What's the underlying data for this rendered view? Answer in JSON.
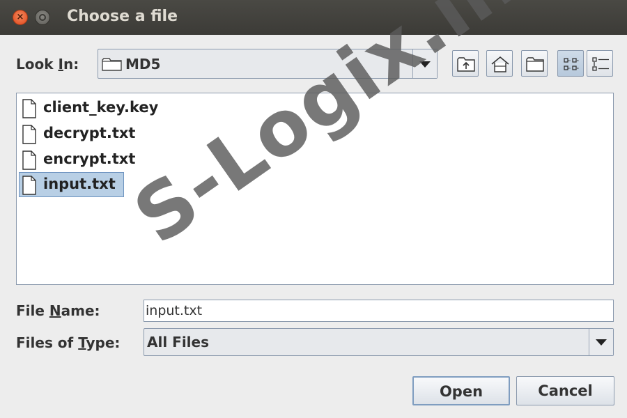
{
  "window": {
    "title": "Choose a file",
    "close_glyph": "×"
  },
  "look_in": {
    "label_pre": "Look ",
    "label_mnemonic": "I",
    "label_post": "n:",
    "value": "MD5",
    "icon": "folder-icon"
  },
  "toolbar": {
    "buttons": [
      {
        "name": "up-one-level-button",
        "icon": "folder-up-icon"
      },
      {
        "name": "home-button",
        "icon": "home-icon"
      },
      {
        "name": "new-folder-button",
        "icon": "new-folder-icon"
      },
      {
        "name": "list-view-button",
        "icon": "list-view-icon",
        "selected": true
      },
      {
        "name": "details-view-button",
        "icon": "details-view-icon"
      }
    ]
  },
  "files": [
    {
      "name": "client_key.key"
    },
    {
      "name": "decrypt.txt"
    },
    {
      "name": "encrypt.txt"
    },
    {
      "name": "input.txt",
      "selected": true
    }
  ],
  "file_name": {
    "label_pre": "File ",
    "label_mnemonic": "N",
    "label_post": "ame:",
    "value": "input.txt"
  },
  "files_of_type": {
    "label_pre": "Files of ",
    "label_mnemonic": "T",
    "label_post": "ype:",
    "value": "All Files"
  },
  "buttons": {
    "open": "Open",
    "cancel": "Cancel"
  },
  "watermark": "S-Logix.in",
  "colors": {
    "titlebar": "#3c3b37",
    "selection": "#b8cfe5",
    "border": "#8a99ad"
  }
}
